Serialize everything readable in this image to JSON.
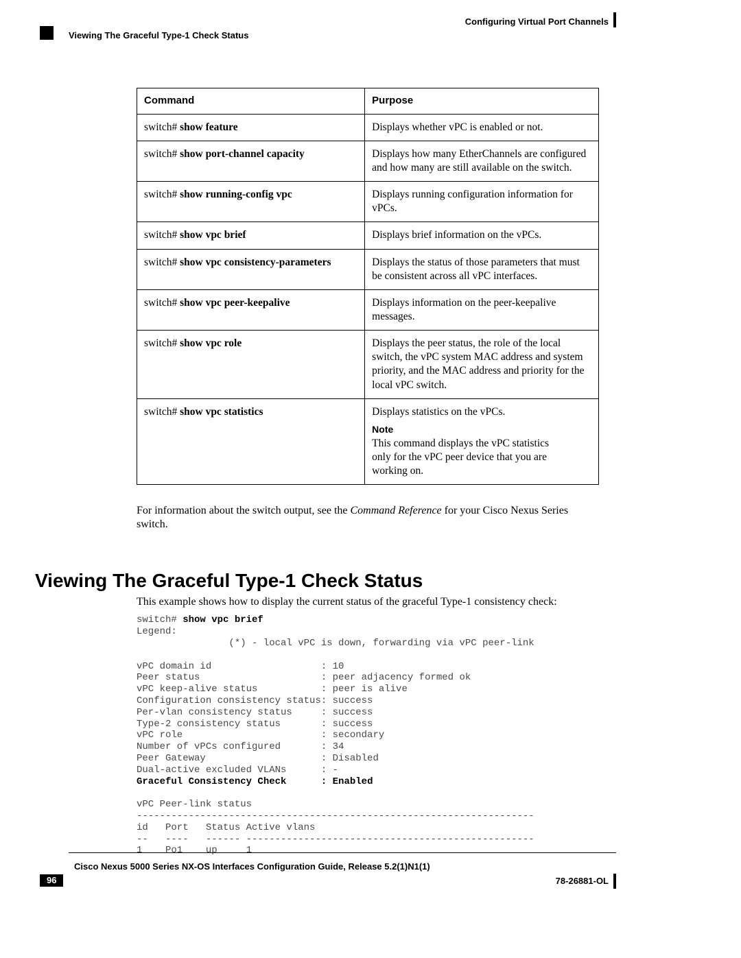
{
  "header": {
    "right": "Configuring Virtual Port Channels",
    "left": "Viewing The Graceful Type-1 Check Status"
  },
  "table": {
    "col1_header": "Command",
    "col2_header": "Purpose",
    "rows": [
      {
        "prefix": "switch# ",
        "cmd": "show feature",
        "purpose": "Displays whether vPC is enabled or not."
      },
      {
        "prefix": "switch# ",
        "cmd": "show port-channel capacity",
        "purpose": "Displays how many EtherChannels are configured and how many are still available on the switch."
      },
      {
        "prefix": "switch# ",
        "cmd": "show running-config vpc",
        "purpose": "Displays running configuration information for vPCs."
      },
      {
        "prefix": "switch# ",
        "cmd": "show vpc brief",
        "purpose": "Displays brief information on the vPCs."
      },
      {
        "prefix": "switch# ",
        "cmd": "show vpc consistency-parameters",
        "purpose": "Displays the status of those parameters that must be consistent across all vPC interfaces."
      },
      {
        "prefix": "switch# ",
        "cmd": "show vpc peer-keepalive",
        "purpose": "Displays information on the peer-keepalive messages."
      },
      {
        "prefix": "switch# ",
        "cmd": "show vpc role",
        "purpose": "Displays the peer status, the role of the local switch, the vPC system MAC address and system priority, and the MAC address and priority for the local vPC switch."
      },
      {
        "prefix": "switch# ",
        "cmd": "show vpc statistics",
        "purpose": "Displays statistics on the vPCs.",
        "note_label": "Note",
        "note": "This command displays the vPC statistics only for the vPC peer device that you are working on."
      }
    ]
  },
  "after_table": {
    "text1": "For information about the switch output, see the ",
    "italic": "Command Reference",
    "text2": " for your Cisco Nexus Series switch."
  },
  "section_heading": "Viewing The Graceful Type-1 Check Status",
  "section_intro": "This example shows how to display the current status of the graceful Type-1 consistency check:",
  "terminal": {
    "line0_a": "switch# ",
    "line0_b": "show vpc brief",
    "line1": "Legend:",
    "line2": "                (*) - local vPC is down, forwarding via vPC peer-link",
    "line3": "",
    "line4": "vPC domain id                   : 10",
    "line5": "Peer status                     : peer adjacency formed ok",
    "line6": "vPC keep-alive status           : peer is alive",
    "line7": "Configuration consistency status: success",
    "line8": "Per-vlan consistency status     : success",
    "line9": "Type-2 consistency status       : success",
    "line10": "vPC role                        : secondary",
    "line11": "Number of vPCs configured       : 34",
    "line12": "Peer Gateway                    : Disabled",
    "line13": "Dual-active excluded VLANs      : -",
    "line14_a": "Graceful Consistency Check      : ",
    "line14_b": "Enabled",
    "line15": "",
    "line16": "vPC Peer-link status",
    "line17": "---------------------------------------------------------------------",
    "line18": "id   Port   Status Active vlans",
    "line19": "--   ----   ------ --------------------------------------------------",
    "line20": "1    Po1    up     1"
  },
  "footer": {
    "title": "Cisco Nexus 5000 Series NX-OS Interfaces Configuration Guide, Release 5.2(1)N1(1)",
    "page": "96",
    "docid": "78-26881-OL"
  }
}
